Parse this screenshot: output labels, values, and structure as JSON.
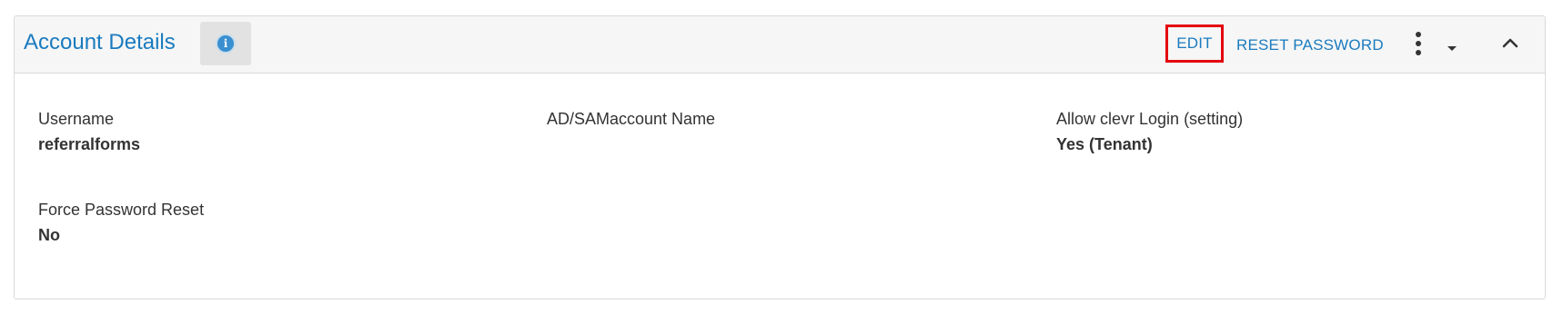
{
  "header": {
    "title": "Account Details",
    "info_icon": "info-icon",
    "actions": {
      "edit": "EDIT",
      "reset_password": "RESET PASSWORD"
    },
    "more_icon": "kebab-menu-icon",
    "dropdown_icon": "caret-down-icon",
    "collapse_icon": "chevron-up-icon"
  },
  "fields": {
    "username": {
      "label": "Username",
      "value": "referralforms"
    },
    "ad_account": {
      "label": "AD/SAMaccount Name",
      "value": ""
    },
    "allow_login": {
      "label": "Allow clevr Login (setting)",
      "value": "Yes (Tenant)"
    },
    "force_reset": {
      "label": "Force Password Reset",
      "value": "No"
    }
  },
  "colors": {
    "accent": "#1a7bbf",
    "highlight_border": "#e3000f",
    "header_bg": "#f6f6f6",
    "info_btn_bg": "#e2e2e2"
  }
}
